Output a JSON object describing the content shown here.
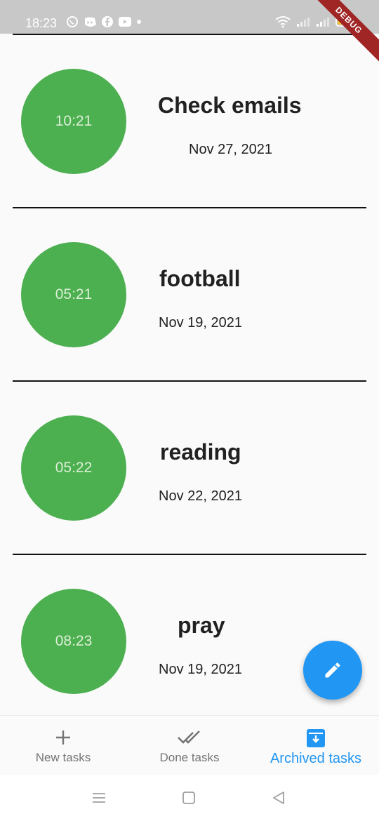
{
  "status_bar": {
    "time": "18:23",
    "left_icons": [
      "whatsapp-icon",
      "discord-icon",
      "facebook-icon",
      "youtube-icon",
      "dot-icon"
    ],
    "right_icons": [
      "wifi-icon",
      "signal-icon",
      "signal-icon",
      "battery-icon"
    ]
  },
  "debug_banner": "DEBUG",
  "tasks": [
    {
      "time": "10:21",
      "title": "Check emails",
      "date": "Nov 27, 2021"
    },
    {
      "time": "05:21",
      "title": "football",
      "date": "Nov 19, 2021"
    },
    {
      "time": "05:22",
      "title": "reading",
      "date": "Nov 22, 2021"
    },
    {
      "time": "08:23",
      "title": "pray",
      "date": "Nov 19, 2021"
    }
  ],
  "fab": {
    "icon": "edit-icon"
  },
  "bottom_nav": {
    "items": [
      {
        "label": "New tasks",
        "icon": "plus-icon",
        "active": false
      },
      {
        "label": "Done tasks",
        "icon": "done-all-icon",
        "active": false
      },
      {
        "label": "Archived tasks",
        "icon": "archive-icon",
        "active": true
      }
    ]
  },
  "colors": {
    "circle": "#4caf50",
    "accent": "#2196f3",
    "status_bar": "#c8c8c8"
  }
}
